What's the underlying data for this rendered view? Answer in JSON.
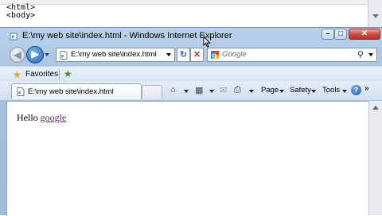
{
  "notepad": {
    "lines": [
      "<html>",
      "<body>"
    ]
  },
  "window": {
    "title": "E:\\my web site\\index.html - Windows Internet Explorer",
    "minimize_glyph": "–",
    "maximize_glyph": "□",
    "close_glyph": "✕"
  },
  "navigation": {
    "back_glyph": "◀",
    "forward_glyph": "▶",
    "address": "E:\\my web site\\index.html",
    "refresh_glyph": "↻",
    "stop_glyph": "✕",
    "search_placeholder": "Google",
    "search_glyph": "⚲"
  },
  "favorites_bar": {
    "label": "Favorites",
    "star_glyph": "★",
    "add_glyph": "★"
  },
  "tab": {
    "label": "E:\\my web site\\index.html"
  },
  "command_bar": {
    "home_glyph": "⌂",
    "feeds_glyph": "▦",
    "mail_glyph": "✉",
    "print_glyph": "⎙",
    "page_label": "Page",
    "safety_label": "Safety",
    "tools_label": "Tools",
    "help_glyph": "?",
    "more_glyph": "»"
  },
  "page": {
    "text": "Hello ",
    "link": "google"
  },
  "icons": {
    "ie_icon": "ie-logo",
    "google_icon": "google-logo"
  }
}
